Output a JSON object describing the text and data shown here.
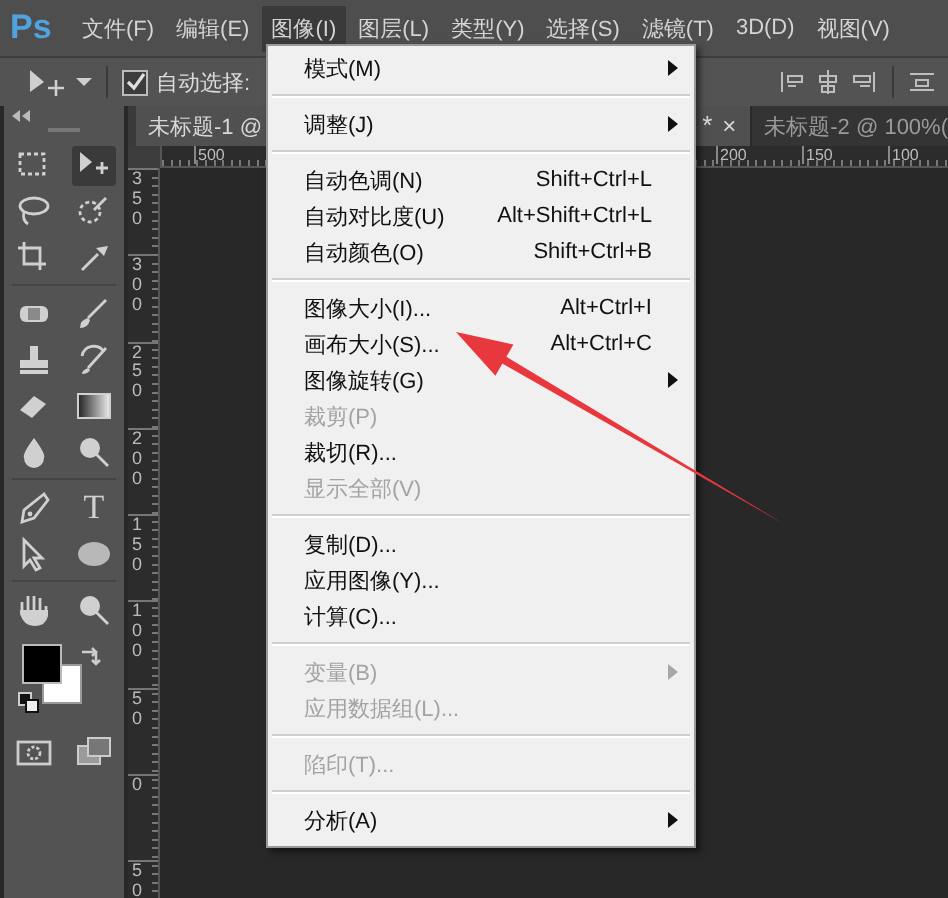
{
  "app": {
    "logo": "Ps"
  },
  "menu_bar": [
    {
      "label": "文件(F)",
      "selected": false
    },
    {
      "label": "编辑(E)",
      "selected": false
    },
    {
      "label": "图像(I)",
      "selected": true
    },
    {
      "label": "图层(L)",
      "selected": false
    },
    {
      "label": "类型(Y)",
      "selected": false
    },
    {
      "label": "选择(S)",
      "selected": false
    },
    {
      "label": "滤镜(T)",
      "selected": false
    },
    {
      "label": "3D(D)",
      "selected": false
    },
    {
      "label": "视图(V)",
      "selected": false
    }
  ],
  "options_bar": {
    "auto_select": {
      "label": "自动选择:",
      "checked": true
    }
  },
  "toolbar": {
    "type_tool_glyph": "T"
  },
  "tabs": [
    {
      "label": "未标题-1 @",
      "selected": true,
      "modified_mark": "*",
      "close_glyph": "×"
    },
    {
      "label": "未标题-2 @ 100%(",
      "selected": false
    }
  ],
  "horizontal_ruler": [
    "500",
    "200",
    "150",
    "100"
  ],
  "vertical_ruler": [
    "350",
    "300",
    "250",
    "200",
    "150",
    "100",
    "50",
    "0",
    "50"
  ],
  "image_menu": {
    "items": [
      {
        "kind": "item",
        "label": "模式(M)",
        "submenu": true,
        "disabled": false
      },
      {
        "kind": "separator"
      },
      {
        "kind": "item",
        "label": "调整(J)",
        "submenu": true,
        "disabled": false
      },
      {
        "kind": "separator"
      },
      {
        "kind": "item",
        "label": "自动色调(N)",
        "shortcut": "Shift+Ctrl+L",
        "disabled": false
      },
      {
        "kind": "item",
        "label": "自动对比度(U)",
        "shortcut": "Alt+Shift+Ctrl+L",
        "disabled": false
      },
      {
        "kind": "item",
        "label": "自动颜色(O)",
        "shortcut": "Shift+Ctrl+B",
        "disabled": false
      },
      {
        "kind": "separator"
      },
      {
        "kind": "item",
        "label": "图像大小(I)...",
        "shortcut": "Alt+Ctrl+I",
        "disabled": false
      },
      {
        "kind": "item",
        "label": "画布大小(S)...",
        "shortcut": "Alt+Ctrl+C",
        "disabled": false
      },
      {
        "kind": "item",
        "label": "图像旋转(G)",
        "submenu": true,
        "disabled": false
      },
      {
        "kind": "item",
        "label": "裁剪(P)",
        "disabled": true
      },
      {
        "kind": "item",
        "label": "裁切(R)...",
        "disabled": false
      },
      {
        "kind": "item",
        "label": "显示全部(V)",
        "disabled": true
      },
      {
        "kind": "separator"
      },
      {
        "kind": "item",
        "label": "复制(D)...",
        "disabled": false
      },
      {
        "kind": "item",
        "label": "应用图像(Y)...",
        "disabled": false
      },
      {
        "kind": "item",
        "label": "计算(C)...",
        "disabled": false
      },
      {
        "kind": "separator"
      },
      {
        "kind": "item",
        "label": "变量(B)",
        "submenu": true,
        "disabled": true
      },
      {
        "kind": "item",
        "label": "应用数据组(L)...",
        "disabled": true
      },
      {
        "kind": "separator"
      },
      {
        "kind": "item",
        "label": "陷印(T)...",
        "disabled": true
      },
      {
        "kind": "separator"
      },
      {
        "kind": "item",
        "label": "分析(A)",
        "submenu": true,
        "disabled": false
      }
    ]
  },
  "annotation_arrow": true
}
